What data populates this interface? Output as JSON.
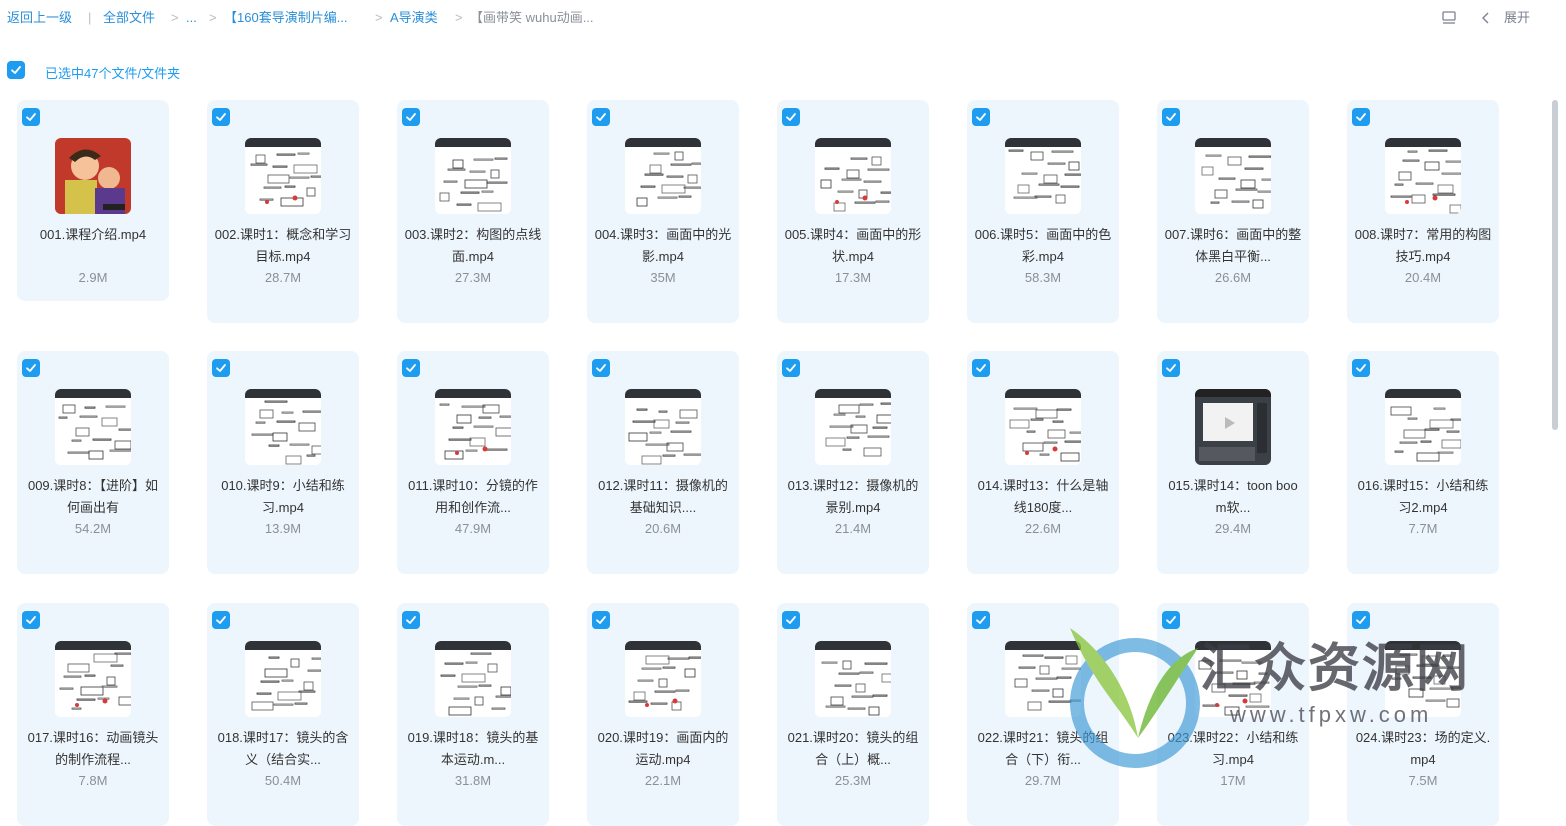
{
  "breadcrumb": {
    "back": "返回上一级",
    "root": "全部文件",
    "ellipsis": "...",
    "folder1": "【160套导演制片编...",
    "folder2": "A导演类",
    "current": "【画带笑 wuhu动画..."
  },
  "header": {
    "expand_label": "展开"
  },
  "selection": {
    "label": "已选中47个文件/文件夹",
    "checked": true
  },
  "colors": {
    "accent": "#1e9df0",
    "card_bg": "#eef6fd",
    "link": "#2a8fd8"
  },
  "files": [
    {
      "name": "001.课程介绍.mp4",
      "size": "2.9M",
      "thumb": "cartoon"
    },
    {
      "name": "002.课时1：概念和学习目标.mp4",
      "size": "28.7M",
      "thumb": "sketch"
    },
    {
      "name": "003.课时2：构图的点线面.mp4",
      "size": "27.3M",
      "thumb": "sketch"
    },
    {
      "name": "004.课时3：画面中的光影.mp4",
      "size": "35M",
      "thumb": "sketch"
    },
    {
      "name": "005.课时4：画面中的形状.mp4",
      "size": "17.3M",
      "thumb": "sketch"
    },
    {
      "name": "006.课时5：画面中的色彩.mp4",
      "size": "58.3M",
      "thumb": "sketch"
    },
    {
      "name": "007.课时6：画面中的整体黑白平衡...",
      "size": "26.6M",
      "thumb": "sketch"
    },
    {
      "name": "008.课时7：常用的构图技巧.mp4",
      "size": "20.4M",
      "thumb": "sketch"
    },
    {
      "name": "009.课时8：【进阶】如何画出有",
      "size": "54.2M",
      "thumb": "sketch"
    },
    {
      "name": "010.课时9：小结和练习.mp4",
      "size": "13.9M",
      "thumb": "sketch"
    },
    {
      "name": "011.课时10：分镜的作用和创作流...",
      "size": "47.9M",
      "thumb": "sketch"
    },
    {
      "name": "012.课时11：摄像机的基础知识....",
      "size": "20.6M",
      "thumb": "sketch"
    },
    {
      "name": "013.课时12：摄像机的景别.mp4",
      "size": "21.4M",
      "thumb": "sketch"
    },
    {
      "name": "014.课时13：什么是轴线180度...",
      "size": "22.6M",
      "thumb": "sketch"
    },
    {
      "name": "015.课时14：toon boom软...",
      "size": "29.4M",
      "thumb": "software"
    },
    {
      "name": "016.课时15：小结和练习2.mp4",
      "size": "7.7M",
      "thumb": "sketch"
    },
    {
      "name": "017.课时16：动画镜头的制作流程...",
      "size": "7.8M",
      "thumb": "sketch"
    },
    {
      "name": "018.课时17：镜头的含义（结合实...",
      "size": "50.4M",
      "thumb": "sketch"
    },
    {
      "name": "019.课时18：镜头的基本运动.m...",
      "size": "31.8M",
      "thumb": "sketch"
    },
    {
      "name": "020.课时19：画面内的运动.mp4",
      "size": "22.1M",
      "thumb": "sketch"
    },
    {
      "name": "021.课时20：镜头的组合（上）概...",
      "size": "25.3M",
      "thumb": "sketch"
    },
    {
      "name": "022.课时21：镜头的组合（下）衔...",
      "size": "29.7M",
      "thumb": "sketch"
    },
    {
      "name": "023.课时22：小结和练习.mp4",
      "size": "17M",
      "thumb": "sketch"
    },
    {
      "name": "024.课时23：场的定义.mp4",
      "size": "7.5M",
      "thumb": "sketch"
    }
  ],
  "watermark": {
    "title": "汇众资源网",
    "url": "www.tfpxw.com"
  }
}
